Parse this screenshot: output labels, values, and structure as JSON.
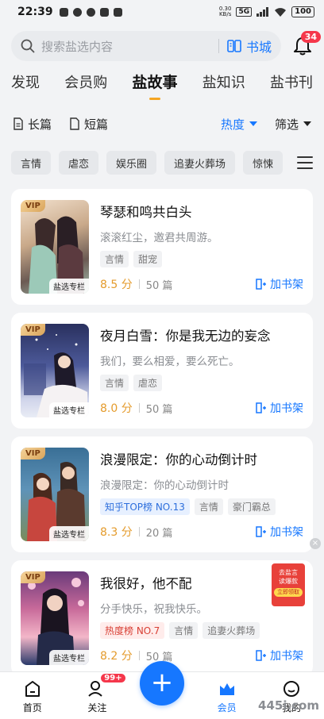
{
  "status_bar": {
    "time": "22:39",
    "net_speed_value": "0.30",
    "net_speed_unit": "KB/s",
    "network": "5G",
    "battery": "100"
  },
  "header": {
    "search_placeholder": "搜索盐选内容",
    "book_city": "书城",
    "notification_count": "34"
  },
  "tabs": [
    "发现",
    "会员购",
    "盐故事",
    "盐知识",
    "盐书刊"
  ],
  "active_tab": "盐故事",
  "filters": {
    "long": "长篇",
    "short": "短篇",
    "sort": "热度",
    "screen": "筛选"
  },
  "chips": [
    "言情",
    "虐恋",
    "娱乐圈",
    "追妻火葬场",
    "惊悚"
  ],
  "books": [
    {
      "vip": "VIP",
      "column": "盐选专栏",
      "title": "琴瑟和鸣共白头",
      "desc": "滚滚红尘，邀君共周游。",
      "tags": [
        {
          "text": "言情",
          "style": "gray"
        },
        {
          "text": "甜宠",
          "style": "gray"
        }
      ],
      "score": "8.5 分",
      "count": "50 篇",
      "add": "加书架"
    },
    {
      "vip": "VIP",
      "column": "盐选专栏",
      "title": "夜月白雪：你是我无边的妄念",
      "desc": "我们，要么相爱，要么死亡。",
      "tags": [
        {
          "text": "言情",
          "style": "gray"
        },
        {
          "text": "虐恋",
          "style": "gray"
        }
      ],
      "score": "8.0 分",
      "count": "50 篇",
      "add": "加书架"
    },
    {
      "vip": "VIP",
      "column": "盐选专栏",
      "title": "浪漫限定：你的心动倒计时",
      "desc": "浪漫限定：你的心动倒计时",
      "tags": [
        {
          "text": "知乎TOP榜 NO.13",
          "style": "blue"
        },
        {
          "text": "言情",
          "style": "gray"
        },
        {
          "text": "豪门霸总",
          "style": "gray"
        }
      ],
      "score": "8.3 分",
      "count": "20 篇",
      "add": "加书架"
    },
    {
      "vip": "VIP",
      "column": "盐选专栏",
      "title": "我很好，他不配",
      "desc": "分手快乐，祝我快乐。",
      "tags": [
        {
          "text": "热度榜 NO.7",
          "style": "red"
        },
        {
          "text": "言情",
          "style": "gray"
        },
        {
          "text": "追妻火葬场",
          "style": "gray"
        }
      ],
      "score": "8.2 分",
      "count": "50 篇",
      "add": "加书架"
    }
  ],
  "ad": {
    "line1": "去盐言",
    "line2": "读爆款",
    "button": "立即领取"
  },
  "bottom_nav": {
    "home": "首页",
    "follow": "关注",
    "follow_badge": "99+",
    "member": "会员",
    "mine": "我的"
  },
  "watermark": "445i.com",
  "colors": {
    "accent": "#1677ff",
    "tab_indicator": "#f5a523",
    "score": "#e49b2c",
    "badge": "#f5374b"
  }
}
